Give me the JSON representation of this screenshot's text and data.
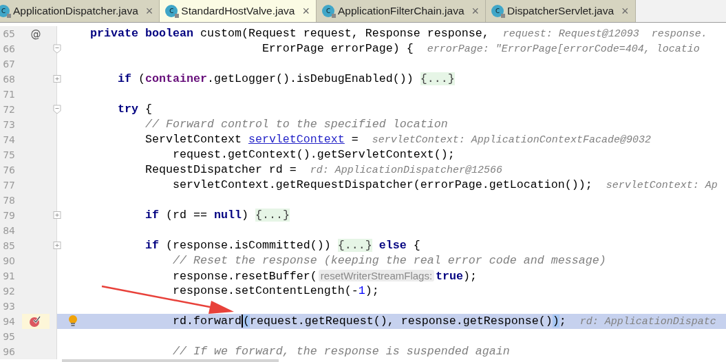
{
  "tabs": [
    {
      "icon_letter": "c",
      "label": "ApplicationDispatcher.java",
      "close": "×",
      "selected": false
    },
    {
      "icon_letter": "c",
      "label": "StandardHostValve.java",
      "close": "×",
      "selected": true
    },
    {
      "icon_letter": "c",
      "label": "ApplicationFilterChain.java",
      "close": "×",
      "selected": false
    },
    {
      "icon_letter": "c",
      "label": "DispatcherServlet.java",
      "close": "×",
      "selected": false
    }
  ],
  "editor": {
    "lines": [
      {
        "number": "65",
        "gutter_mark": "@",
        "tokens": [
          {
            "kind": "keyword",
            "text": "    private boolean"
          },
          {
            "kind": "plain",
            "text": " custom(Request request, Response response,"
          },
          {
            "kind": "hint",
            "text": "request: Request@12093  response."
          }
        ]
      },
      {
        "number": "66",
        "expanded": true,
        "tokens": [
          {
            "kind": "plain",
            "text": "                             ErrorPage errorPage) {"
          },
          {
            "kind": "hint",
            "text": "errorPage: \"ErrorPage[errorCode=404, locatio"
          }
        ]
      },
      {
        "number": "67"
      },
      {
        "number": "68",
        "expanded": false,
        "tokens": [
          {
            "kind": "keyword",
            "text": "        if"
          },
          {
            "kind": "plain",
            "text": " ("
          },
          {
            "kind": "field",
            "text": "container"
          },
          {
            "kind": "plain",
            "text": ".getLogger().isDebugEnabled()) "
          },
          {
            "kind": "folded",
            "text": "{...}"
          }
        ]
      },
      {
        "number": "71"
      },
      {
        "number": "72",
        "expanded": true,
        "tokens": [
          {
            "kind": "keyword",
            "text": "        try"
          },
          {
            "kind": "plain",
            "text": " {"
          }
        ]
      },
      {
        "number": "73",
        "tokens": [
          {
            "kind": "comment",
            "text": "            // Forward control to the specified location"
          }
        ]
      },
      {
        "number": "74",
        "tokens": [
          {
            "kind": "plain",
            "text": "            ServletContext "
          },
          {
            "kind": "link",
            "text": "servletContext"
          },
          {
            "kind": "plain",
            "text": " ="
          },
          {
            "kind": "hint",
            "text": "servletContext: ApplicationContextFacade@9032"
          }
        ]
      },
      {
        "number": "75",
        "tokens": [
          {
            "kind": "plain",
            "text": "                request.getContext().getServletContext();"
          }
        ]
      },
      {
        "number": "76",
        "tokens": [
          {
            "kind": "plain",
            "text": "            RequestDispatcher rd ="
          },
          {
            "kind": "hint",
            "text": "rd: ApplicationDispatcher@12566"
          }
        ]
      },
      {
        "number": "77",
        "tokens": [
          {
            "kind": "plain",
            "text": "                servletContext.getRequestDispatcher(errorPage.getLocation());"
          },
          {
            "kind": "hint",
            "text": "servletContext: Ap"
          }
        ]
      },
      {
        "number": "78"
      },
      {
        "number": "79",
        "expanded": false,
        "tokens": [
          {
            "kind": "keyword",
            "text": "            if"
          },
          {
            "kind": "plain",
            "text": " (rd == "
          },
          {
            "kind": "keyword",
            "text": "null"
          },
          {
            "kind": "plain",
            "text": ") "
          },
          {
            "kind": "folded",
            "text": "{...}"
          }
        ]
      },
      {
        "number": "84"
      },
      {
        "number": "85",
        "expanded": false,
        "tokens": [
          {
            "kind": "keyword",
            "text": "            if"
          },
          {
            "kind": "plain",
            "text": " (response.isCommitted()) "
          },
          {
            "kind": "folded",
            "text": "{...}"
          },
          {
            "kind": "keyword",
            "text": " else"
          },
          {
            "kind": "plain",
            "text": " {"
          }
        ]
      },
      {
        "number": "90",
        "tokens": [
          {
            "kind": "comment",
            "text": "                // Reset the response (keeping the real error code and message)"
          }
        ]
      },
      {
        "number": "91",
        "tokens": [
          {
            "kind": "plain",
            "text": "                response.resetBuffer("
          },
          {
            "kind": "param",
            "text": "resetWriterStreamFlags:"
          },
          {
            "kind": "keyword",
            "text": "true"
          },
          {
            "kind": "plain",
            "text": ");"
          }
        ]
      },
      {
        "number": "92",
        "tokens": [
          {
            "kind": "plain",
            "text": "                response.setContentLength(-"
          },
          {
            "kind": "number",
            "text": "1"
          },
          {
            "kind": "plain",
            "text": ");"
          }
        ]
      },
      {
        "number": "93"
      },
      {
        "number": "94",
        "current": true,
        "breakpoint": true,
        "bulb": true,
        "tokens": [
          {
            "kind": "plain",
            "text": "                rd.forward"
          },
          {
            "kind": "brace",
            "text": "(",
            "caret": true
          },
          {
            "kind": "plain",
            "text": "request.getRequest(), response.getResponse()"
          },
          {
            "kind": "brace",
            "text": ")",
            "caret": false
          },
          {
            "kind": "plain",
            "text": ";"
          },
          {
            "kind": "hint",
            "text": "rd: ApplicationDispatc"
          }
        ]
      },
      {
        "number": "95"
      },
      {
        "number": "96",
        "tokens": [
          {
            "kind": "comment",
            "text": "                // If we forward, the response is suspended again"
          }
        ]
      }
    ]
  }
}
